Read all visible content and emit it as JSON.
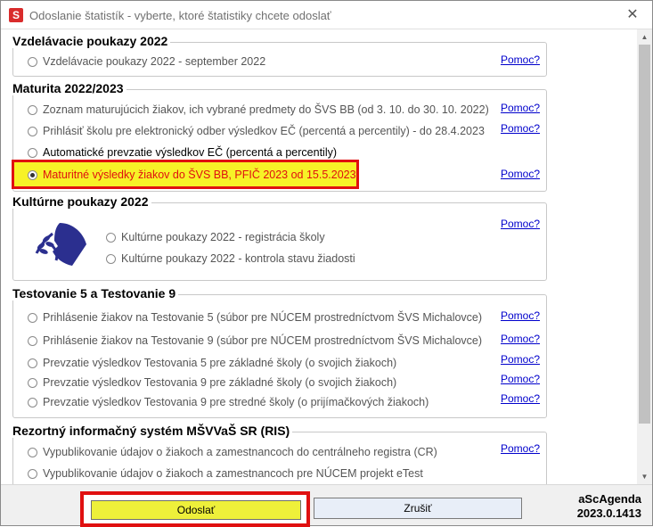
{
  "window": {
    "title": "Odoslanie štatistík - vyberte, ktoré štatistiky chcete odoslať",
    "app_icon_letter": "S",
    "close_glyph": "✕"
  },
  "help_label": "Pomoc?",
  "groups": [
    {
      "title": "Vzdelávacie poukazy 2022",
      "options": [
        {
          "label": "Vzdelávacie poukazy 2022 - september 2022",
          "checked": false,
          "has_help": true
        }
      ]
    },
    {
      "title": "Maturita 2022/2023",
      "options": [
        {
          "label": "Zoznam maturujúcich žiakov, ich vybrané predmety do ŠVS BB (od 3. 10. do 30. 10. 2022)",
          "checked": false,
          "has_help": true
        },
        {
          "label": "Prihlásiť školu pre elektronický odber výsledkov EČ (percentá a percentily) - do 28.4.2023",
          "checked": false,
          "has_help": true
        },
        {
          "label": "Automatické prevzatie výsledkov EČ (percentá a percentily)",
          "checked": false,
          "has_help": false
        },
        {
          "label": "Maturitné výsledky žiakov do ŠVS BB, PFIČ 2023 od 15.5.2023",
          "checked": true,
          "has_help": true,
          "highlighted": true
        }
      ]
    },
    {
      "title": "Kultúrne poukazy 2022",
      "logo": "kulturne-poukazy-logo",
      "options": [
        {
          "label": "Kultúrne poukazy 2022 - registrácia školy",
          "checked": false
        },
        {
          "label": "Kultúrne poukazy 2022 - kontrola stavu žiadosti",
          "checked": false
        }
      ]
    },
    {
      "title": "Testovanie 5 a Testovanie 9",
      "options": [
        {
          "label": "Prihlásenie žiakov na Testovanie 5 (súbor pre NÚCEM prostredníctvom ŠVS Michalovce)",
          "checked": false,
          "has_help": true
        },
        {
          "label": "Prihlásenie žiakov na Testovanie 9 (súbor pre NÚCEM prostredníctvom ŠVS Michalovce)",
          "checked": false,
          "has_help": true
        },
        {
          "label": "Prevzatie výsledkov Testovania 5 pre základné školy (o svojich žiakoch)",
          "checked": false,
          "has_help": true
        },
        {
          "label": "Prevzatie výsledkov Testovania 9 pre základné školy (o svojich žiakoch)",
          "checked": false,
          "has_help": true
        },
        {
          "label": "Prevzatie výsledkov Testovania 9 pre stredné školy (o prijímačkových žiakoch)",
          "checked": false,
          "has_help": true
        }
      ]
    },
    {
      "title": "Rezortný informačný systém MŠVVaŠ SR (RIS)",
      "options": [
        {
          "label": "Vypublikovanie údajov o žiakoch a zamestnancoch do centrálneho registra (CR)",
          "checked": false,
          "has_help": true
        },
        {
          "label": "Vypublikovanie údajov o žiakoch a zamestnancoch pre NÚCEM projekt eTest",
          "checked": false,
          "has_help": false
        }
      ]
    }
  ],
  "footer": {
    "send_label": "Odoslať",
    "cancel_label": "Zrušiť",
    "brand_name": "aScAgenda",
    "version": "2023.0.1413"
  },
  "colors": {
    "highlight_border": "#e01010",
    "highlight_fill": "#f7f227",
    "link": "#0000cc"
  }
}
